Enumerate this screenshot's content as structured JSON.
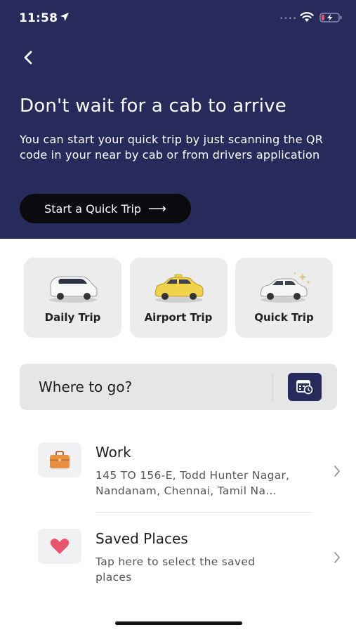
{
  "status_bar": {
    "time": "11:58",
    "icons": [
      "location-arrow-icon",
      "wifi-icon",
      "battery-charging-icon"
    ]
  },
  "hero": {
    "background": "#262b5c",
    "title": "Don't wait for a cab to arrive",
    "subtitle": "You can start your quick trip by just scanning the QR code in your near by cab or from drivers application",
    "cta_label": "Start a Quick Trip",
    "cta_arrow": "⟶"
  },
  "trip_types": [
    {
      "label": "Daily Trip",
      "icon": "van-icon"
    },
    {
      "label": "Airport Trip",
      "icon": "taxi-icon"
    },
    {
      "label": "Quick Trip",
      "icon": "sparkle-car-icon"
    }
  ],
  "search": {
    "placeholder": "Where to go?",
    "schedule_icon": "calendar-clock-icon"
  },
  "places": [
    {
      "title": "Work",
      "description": "145 TO 156-E, Todd Hunter Nagar, Nandanam, Chennai, Tamil Na...",
      "icon": "briefcase-icon"
    },
    {
      "title": "Saved Places",
      "description": "Tap here to select the saved places",
      "icon": "heart-icon"
    }
  ],
  "colors": {
    "primary": "#262b5c",
    "button_dark": "#0b0b0f",
    "card_bg": "#ececec",
    "taxi_yellow": "#f2d24b",
    "heart": "#e8556f",
    "briefcase": "#e88f43"
  }
}
